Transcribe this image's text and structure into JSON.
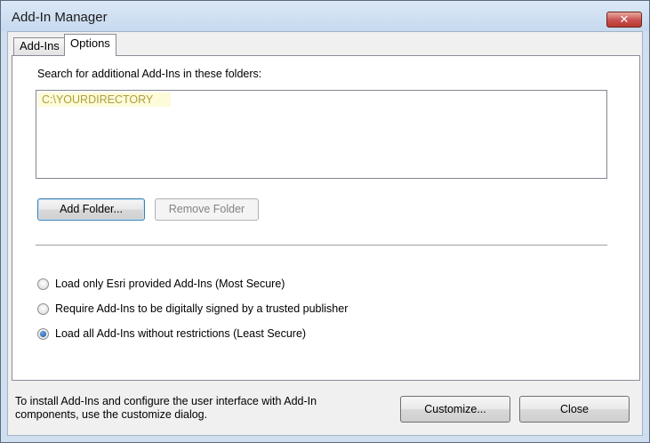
{
  "window": {
    "title": "Add-In Manager",
    "close_glyph": "✕"
  },
  "tabs": [
    {
      "label": "Add-Ins",
      "selected": false
    },
    {
      "label": "Options",
      "selected": true
    }
  ],
  "options": {
    "search_label": "Search for additional Add-Ins in these folders:",
    "folders": [
      "C:\\YOURDIRECTORY"
    ],
    "add_folder_label": "Add Folder...",
    "remove_folder_label": "Remove Folder",
    "security": [
      {
        "label": "Load only Esri provided Add-Ins (Most Secure)",
        "checked": false
      },
      {
        "label": "Require Add-Ins to be digitally signed by a trusted publisher",
        "checked": false
      },
      {
        "label": "Load all Add-Ins without restrictions (Least Secure)",
        "checked": true
      }
    ]
  },
  "footer": {
    "line1": "To install Add-Ins and configure the user interface with Add-In",
    "line2": "components, use the customize dialog.",
    "customize_label": "Customize...",
    "close_label": "Close"
  },
  "colors": {
    "title_bar": "#cfdff0",
    "selected_folder_bg": "#fdfbd9",
    "selected_folder_text": "#aca040"
  }
}
